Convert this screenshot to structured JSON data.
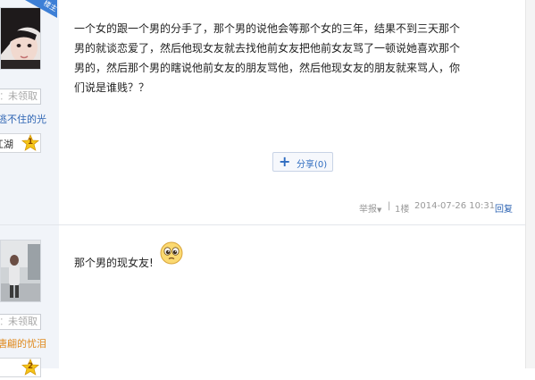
{
  "post1": {
    "author_badge": "楼主",
    "gift_label": "：",
    "gift_value": "未领取",
    "username": "逃不住的光",
    "level_text": "江湖",
    "level_num": "1",
    "content": "一个女的跟一个男的分手了，那个男的说他会等那个女的三年，结果不到三天那个男的就谈恋爱了，然后他现女友就去找他前女友把他前女友骂了一顿说她喜欢那个男的，然后那个男的瞎说他前女友的朋友骂他，然后他现女友的朋友就来骂人，你们说是谁贱？？",
    "share_label": "分享",
    "share_count": "(0)",
    "report_label": "举报",
    "floor": "1楼",
    "timestamp": "2014-07-26 10:31",
    "reply_label": "回复"
  },
  "post2": {
    "gift_label": "：",
    "gift_value": "未领取",
    "username": "唐翩的忧泪",
    "level_num": "2",
    "content": "那个男的现女友!"
  },
  "colors": {
    "link_blue": "#2d64b3",
    "orange_user": "#e08a1e",
    "sidebar_bg": "#f1f4f9",
    "badge_blue": "#3d7fd6"
  },
  "icons": {
    "share": "plus-icon",
    "report_dropdown": "chevron-down-icon",
    "level": "star-icon",
    "emoji": "tearful-face-icon"
  }
}
